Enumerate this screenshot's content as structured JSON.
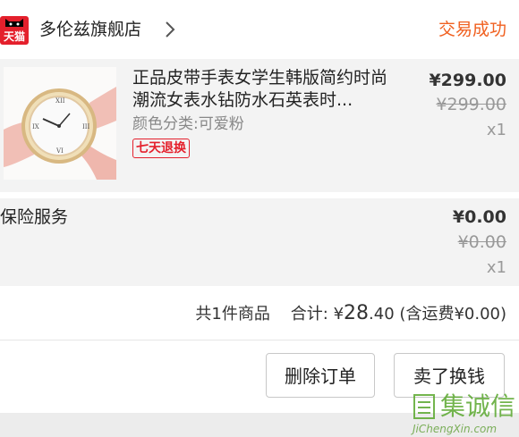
{
  "header": {
    "logo_text": "天猫",
    "store_name": "多伦兹旗舰店",
    "status": "交易成功"
  },
  "product": {
    "title": "正品皮带手表女学生韩版简约时尚潮流女表水钻防水石英表时...",
    "variant": "颜色分类:可爱粉",
    "badge": "七天退换",
    "price": "¥299.00",
    "original_price": "¥299.00",
    "quantity": "x1"
  },
  "insurance": {
    "label": "保险服务",
    "price": "¥0.00",
    "original_price": "¥0.00",
    "quantity": "x1"
  },
  "summary": {
    "count_text": "共1件商品",
    "total_label": "合计: ¥",
    "total_int": "28",
    "total_dec": ".40",
    "shipping": "(含运费¥0.00)"
  },
  "actions": {
    "delete_label": "删除订单",
    "sell_label": "卖了换钱"
  },
  "watermark": {
    "text": "集诚信",
    "domain": "JiChengXin.com"
  }
}
